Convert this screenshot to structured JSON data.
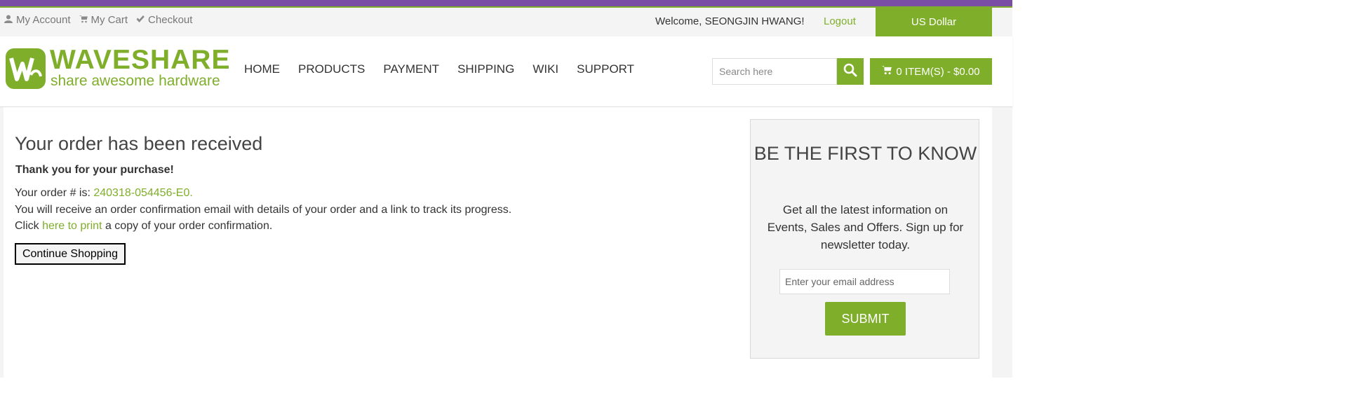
{
  "topbar": {
    "links": [
      {
        "label": "My Account",
        "icon": "user-icon"
      },
      {
        "label": "My Cart",
        "icon": "cart-icon"
      },
      {
        "label": "Checkout",
        "icon": "check-icon"
      }
    ],
    "welcome": "Welcome, SEONGJIN HWANG!",
    "logout": "Logout",
    "currency": "US Dollar"
  },
  "header": {
    "logo_word": "WAVESHARE",
    "logo_tagline": "share awesome hardware",
    "nav": [
      "HOME",
      "PRODUCTS",
      "PAYMENT",
      "SHIPPING",
      "WIKI",
      "SUPPORT"
    ],
    "search_placeholder": "Search here",
    "search_icon": "search-icon",
    "cart_label": "0 ITEM(S) - $0.00"
  },
  "order": {
    "title": "Your order has been received",
    "thanks": "Thank you for your purchase!",
    "order_prefix": "Your order # is: ",
    "order_number": "240318-054456-E0",
    "order_suffix": ".",
    "confirmation_text": "You will receive an order confirmation email with details of your order and a link to track its progress.",
    "print_prefix": "Click ",
    "print_link": "here to print",
    "print_suffix": " a copy of your order confirmation.",
    "continue_label": "Continue Shopping"
  },
  "newsletter": {
    "title": "BE THE FIRST TO KNOW",
    "text": "Get all the latest information on Events, Sales and Offers. Sign up for newsletter today.",
    "email_placeholder": "Enter your email address",
    "submit_label": "SUBMIT"
  },
  "colors": {
    "accent": "#7fae2a",
    "top_bar": "#7b4ea5"
  }
}
